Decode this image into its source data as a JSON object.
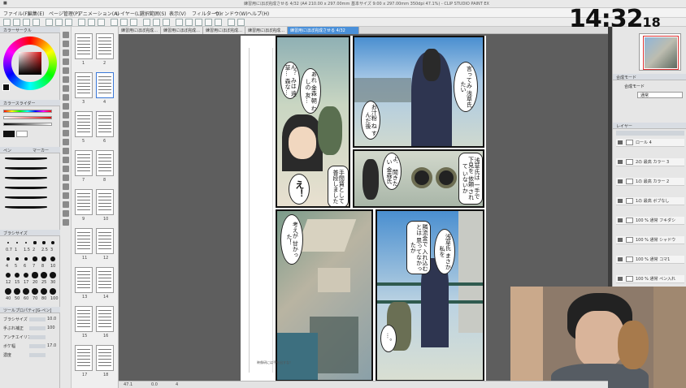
{
  "window": {
    "title": "練習用にほぼ完成させる 4/32 (A4 210.00 x 297.00mm 基本サイズ 9:00 x 297.00mm 350dpi 47.1%) - CLIP STUDIO PAINT EX"
  },
  "menu": {
    "items": [
      "ファイル(F)",
      "編集(E)",
      "ページ管理(P)",
      "アニメーション(A)",
      "レイヤー(L)",
      "選択範囲(S)",
      "表示(V)",
      "フィルター(I)",
      "ウィンドウ(W)",
      "ヘルプ(H)"
    ]
  },
  "clock": {
    "time": "14:32",
    "seconds": "18"
  },
  "left_panel": {
    "color_header": "カラーサークル",
    "color_slider_header": "カラースライダー",
    "subtool_header": "ペン",
    "subtool_tab2": "マーカー",
    "brush_size_header": "ブラシサイズ",
    "tool_property_header": "ツールプロパティ[G-ペン]",
    "props": [
      {
        "label": "ブラシサイズ",
        "value": "10.0"
      },
      {
        "label": "手ぶれ補正",
        "value": "100"
      },
      {
        "label": "アンチエイリアス",
        "value": ""
      },
      {
        "label": "ボケ幅",
        "value": "17.0"
      },
      {
        "label": "濃度",
        "value": ""
      }
    ],
    "brush_sizes": [
      "0.7",
      "1",
      "1.5",
      "2",
      "2.5",
      "3",
      "4",
      "5",
      "6",
      "7",
      "8",
      "10",
      "12",
      "15",
      "17",
      "20",
      "25",
      "30",
      "40",
      "50",
      "60",
      "70",
      "80",
      "100"
    ]
  },
  "page_thumbs": [
    "1",
    "2",
    "3",
    "4",
    "5",
    "6",
    "7",
    "8",
    "9",
    "10",
    "11",
    "12",
    "13",
    "14",
    "15",
    "16",
    "17",
    "18"
  ],
  "tabs": [
    "練習用にほぼ完成…",
    "練習用にほぼ完成…",
    "練習用にほぼ完成…",
    "練習用にほぼ完成…",
    "練習用にほぼ完成させる 4/32"
  ],
  "manga": {
    "bubbles": {
      "p1a": "ん？ みは 遠草… 森な…",
      "p1b": "あれ 金森 朝 わしの 友…",
      "p1c": "え！",
      "p1d": "手間賃として 普段しました",
      "p2a": "言ってみ 浅草氏 たい",
      "p2b": "お汁粉 ね すんだ後",
      "p3a": "よ、 聞きたい 金森氏",
      "p3b": "浅草氏は 一手で 下見を 依頼 されて いないか",
      "p4": "考えが 甘かった！",
      "p5a": "浅草氏 まさか 私を",
      "p5b": "隣流金で 入れ込むとは 思ってなかったか",
      "p5c": "…。"
    },
    "footer": "映像研には手を出すな！"
  },
  "right_panel": {
    "layer_header": "レイヤー",
    "layers": [
      "ロール 4",
      "2の 最高 カラー 3",
      "1の 最高 カラー 2",
      "1の 最高 ボブなし",
      "100 % 通常 フキダシ",
      "100 % 通常 シャドウ",
      "100 % 通常 コマ1",
      "100 % 通常 ペン入れ",
      "100 % 通常 下描き",
      "100 % 通常 フォルダー",
      "100 % 通常 用紙",
      "100 % 通常 枠線"
    ],
    "blend_label": "合成モード",
    "blend_value": "通常",
    "opacity": "100"
  },
  "status": {
    "zoom": "47.1",
    "angle": "0.0",
    "page": "4"
  }
}
